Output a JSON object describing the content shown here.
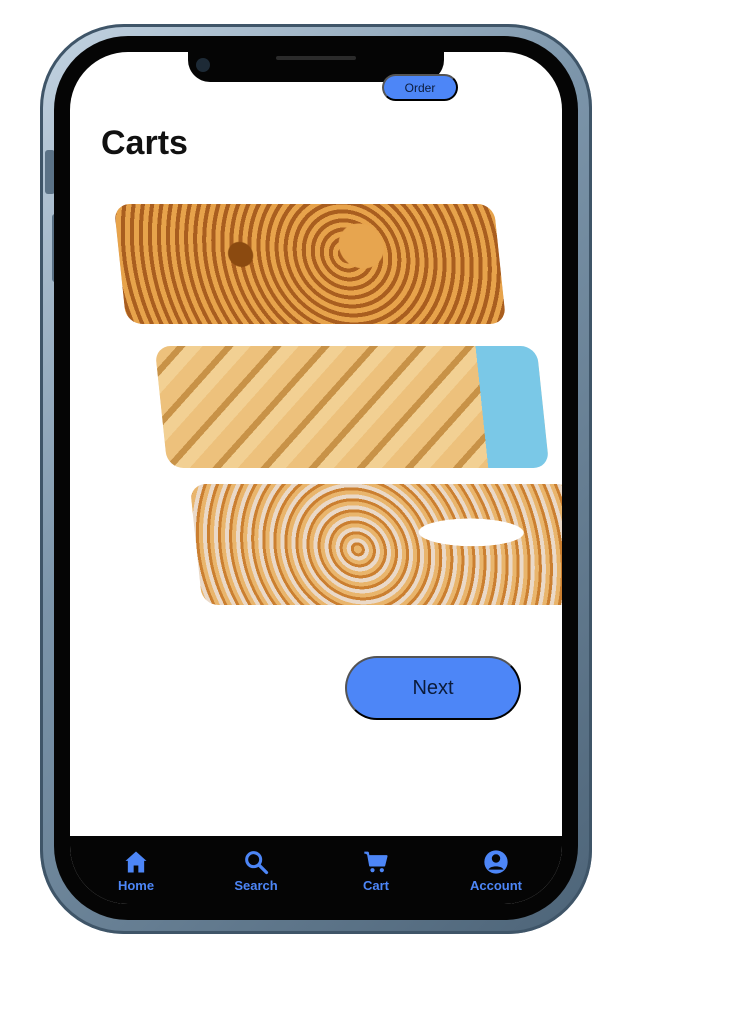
{
  "header": {
    "order_button_label": "Order",
    "title": "Carts"
  },
  "actions": {
    "next_label": "Next"
  },
  "tab_bar": [
    {
      "label": "Home",
      "icon": "home-icon"
    },
    {
      "label": "Search",
      "icon": "search-icon"
    },
    {
      "label": "Cart",
      "icon": "cart-icon"
    },
    {
      "label": "Account",
      "icon": "account-icon"
    }
  ],
  "colors": {
    "accent": "#4d86f7",
    "tab_bar_bg": "#050505",
    "screen_bg": "#ffffff",
    "phone_frame": "#6f889e"
  }
}
